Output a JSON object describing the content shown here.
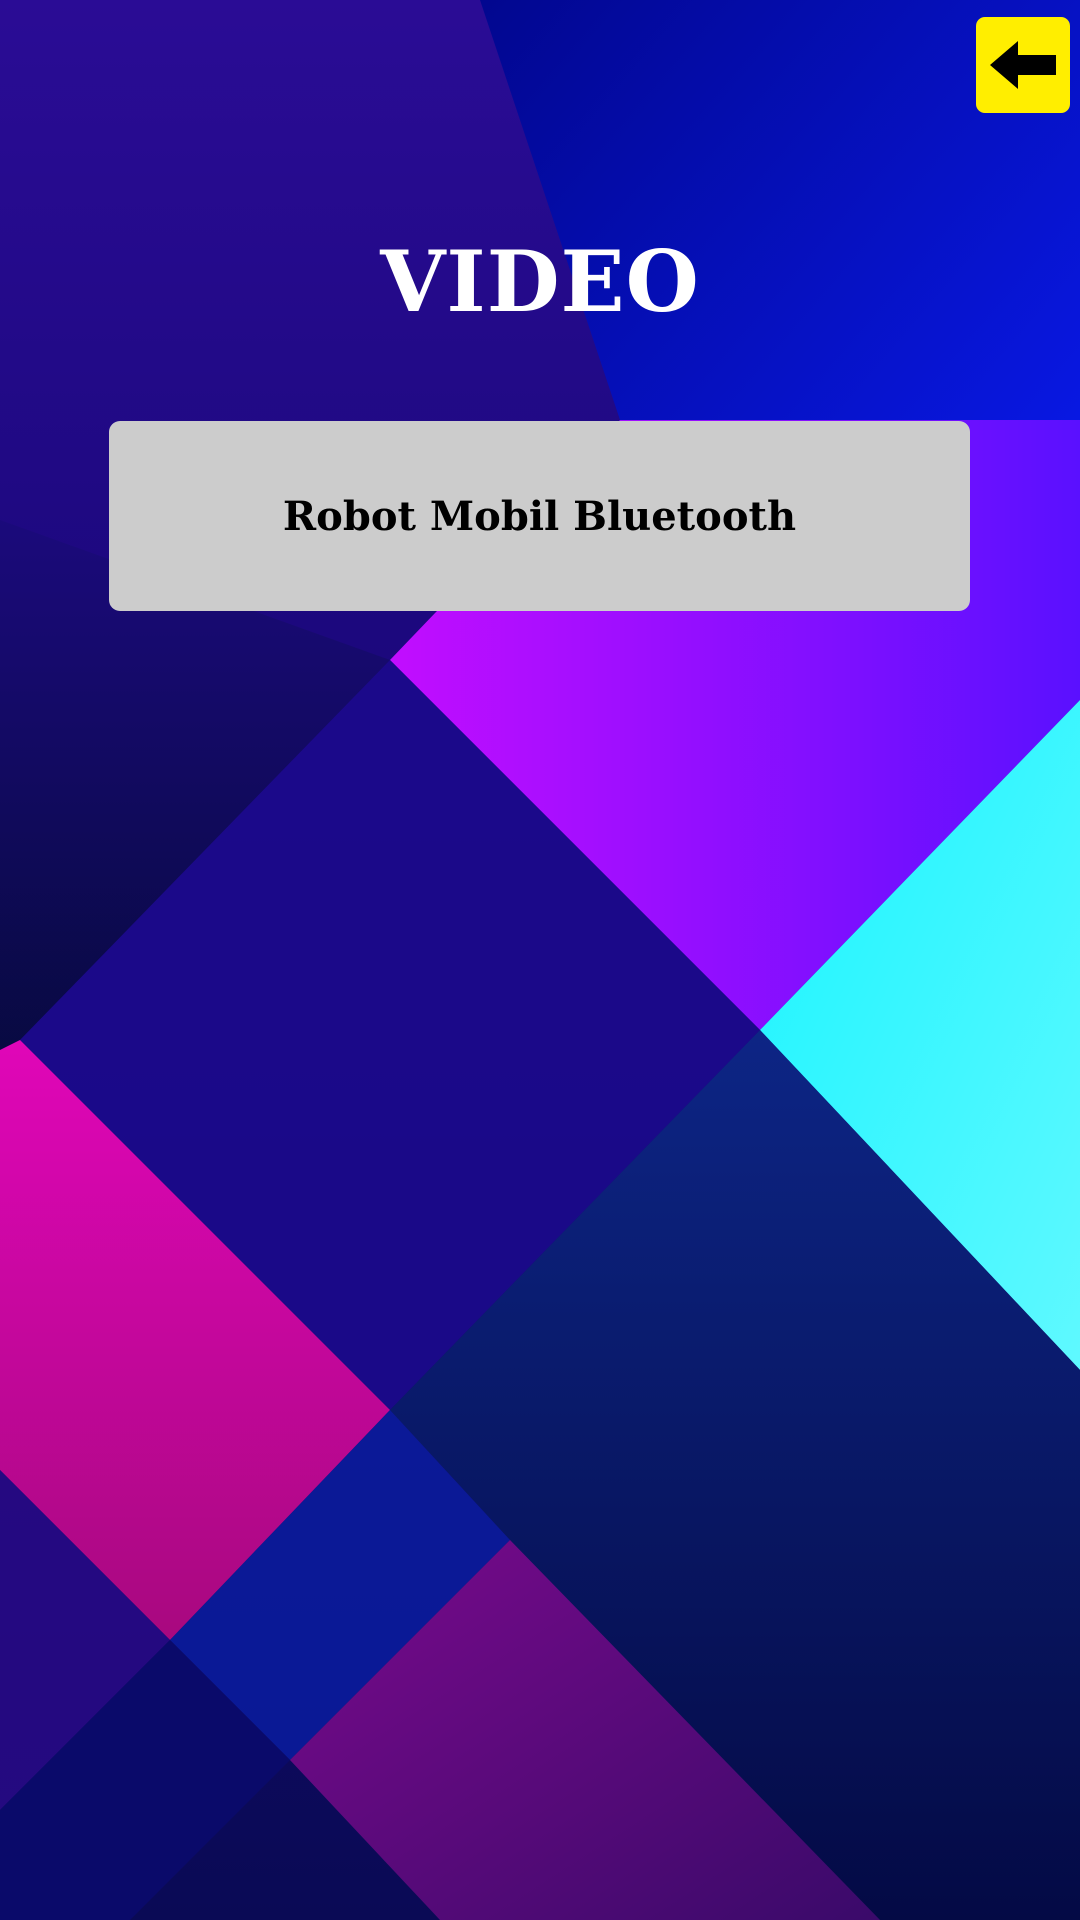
{
  "screen": {
    "title": "VIDEO"
  },
  "header": {
    "back_icon": "arrow-left-icon"
  },
  "menu": {
    "items": [
      {
        "label": "Robot Mobil Bluetooth"
      }
    ]
  },
  "colors": {
    "back_button": "#ffee00",
    "item_button": "#cccccc",
    "title_text": "#ffffff",
    "item_text": "#000000",
    "bg_deep_navy": "#0a0850",
    "bg_indigo": "#1a0a8a",
    "bg_blue": "#0a1cf5",
    "bg_purple": "#b010ff",
    "bg_cyan": "#18f4ff",
    "bg_magenta": "#d806b4"
  }
}
